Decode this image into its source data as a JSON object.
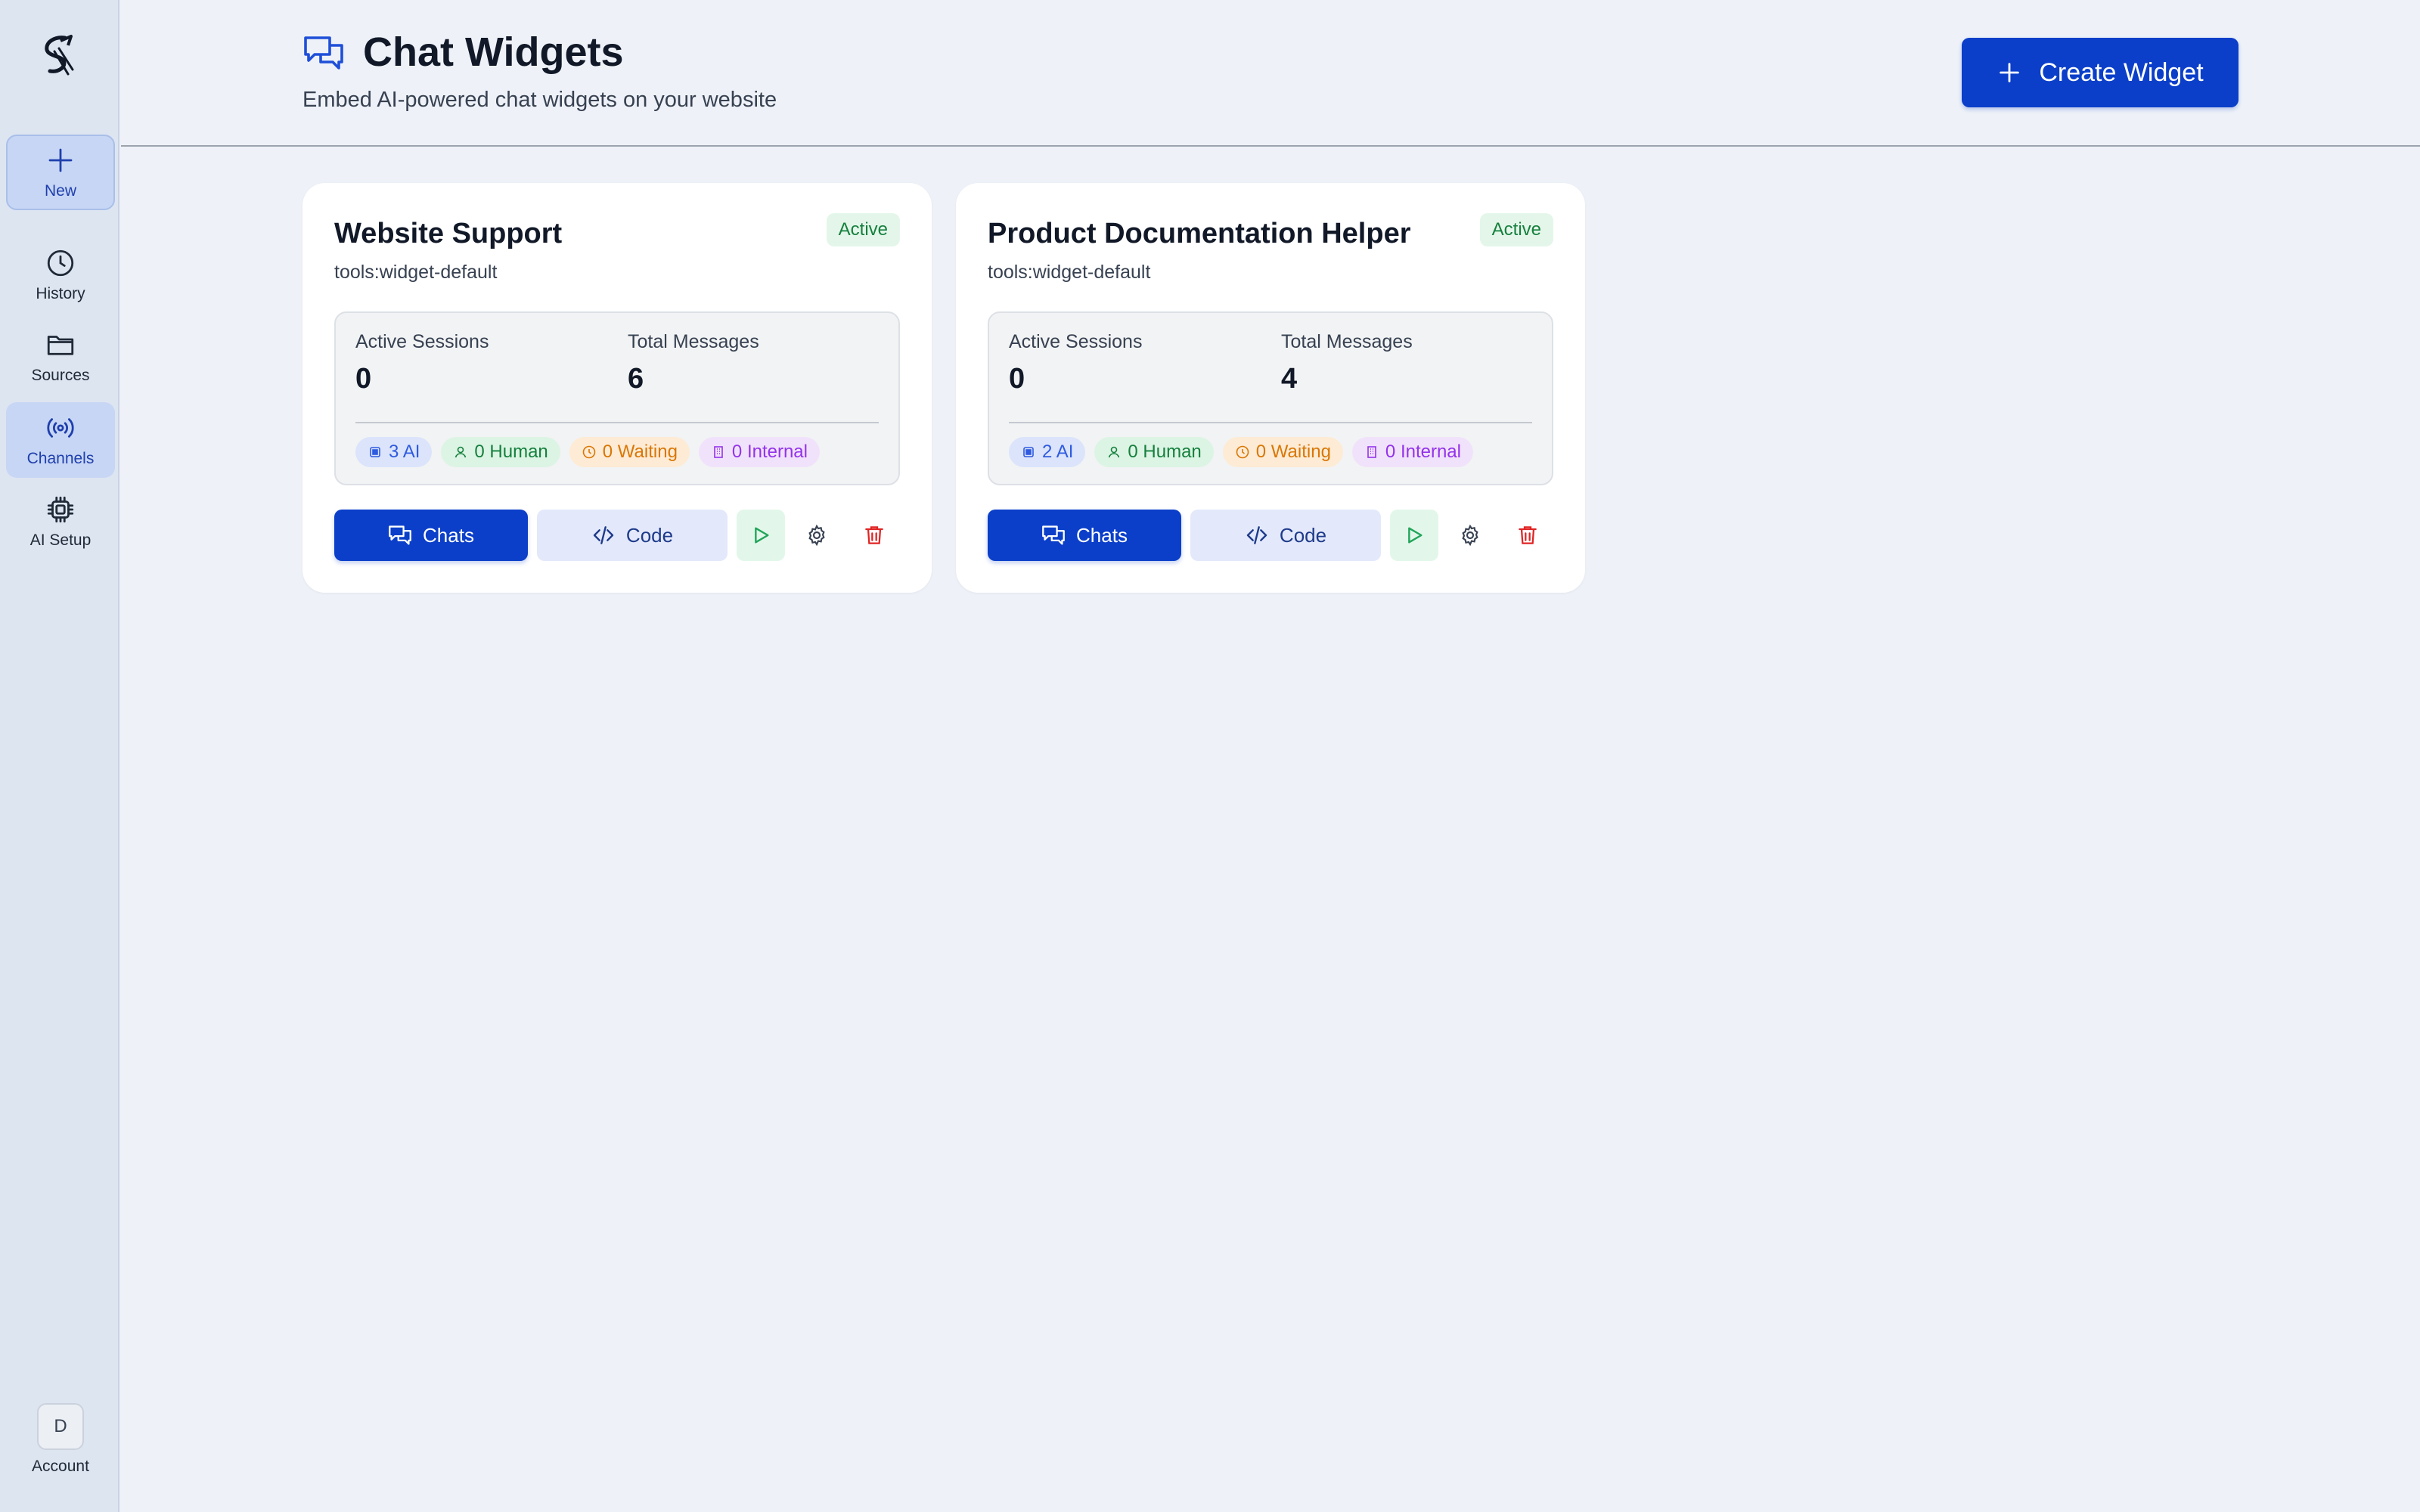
{
  "sidebar": {
    "items": [
      {
        "id": "new",
        "label": "New",
        "icon": "plus-icon"
      },
      {
        "id": "history",
        "label": "History",
        "icon": "clock-icon"
      },
      {
        "id": "sources",
        "label": "Sources",
        "icon": "folder-icon"
      },
      {
        "id": "channels",
        "label": "Channels",
        "icon": "broadcast-icon"
      },
      {
        "id": "ai-setup",
        "label": "AI Setup",
        "icon": "chip-icon"
      }
    ],
    "account": {
      "initial": "D",
      "label": "Account"
    }
  },
  "header": {
    "title": "Chat Widgets",
    "subtitle": "Embed AI-powered chat widgets on your website",
    "create_label": "Create Widget"
  },
  "widgets": [
    {
      "name": "Website Support",
      "tool": "tools:widget-default",
      "status": "Active",
      "active_sessions_label": "Active Sessions",
      "active_sessions": "0",
      "total_messages_label": "Total Messages",
      "total_messages": "6",
      "chips": {
        "ai": "3 AI",
        "human": "0 Human",
        "waiting": "0 Waiting",
        "internal": "0 Internal"
      },
      "chats_label": "Chats",
      "code_label": "Code"
    },
    {
      "name": "Product Documentation Helper",
      "tool": "tools:widget-default",
      "status": "Active",
      "active_sessions_label": "Active Sessions",
      "active_sessions": "0",
      "total_messages_label": "Total Messages",
      "total_messages": "4",
      "chips": {
        "ai": "2 AI",
        "human": "0 Human",
        "waiting": "0 Waiting",
        "internal": "0 Internal"
      },
      "chats_label": "Chats",
      "code_label": "Code"
    }
  ],
  "colors": {
    "accent": "#0b3fc9",
    "active_green": "#15803d",
    "delete_red": "#e02424",
    "background": "#eef2f8",
    "sidebar": "#dde5f1"
  }
}
